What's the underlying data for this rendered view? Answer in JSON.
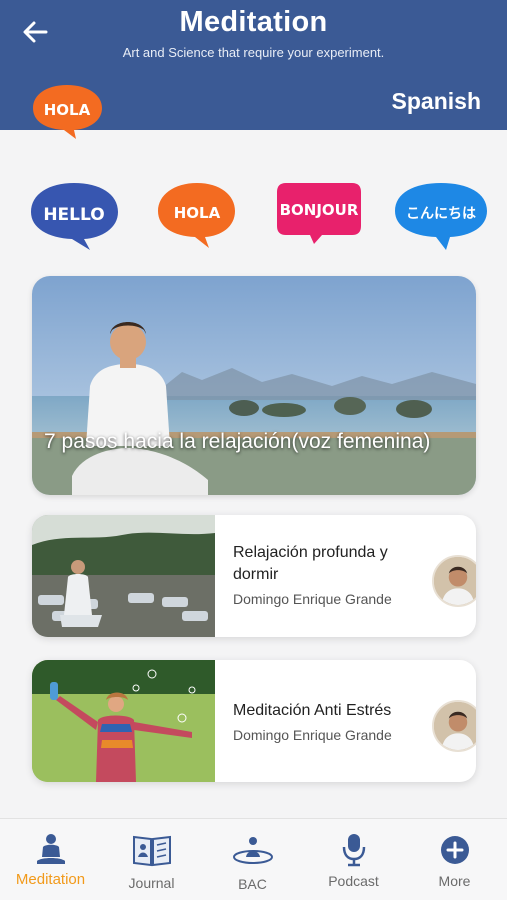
{
  "header": {
    "title": "Meditation",
    "subtitle": "Art and Science that require your experiment.",
    "selected_language": "Spanish",
    "selected_bubble_text": "HOLA",
    "background": "#3b5a95"
  },
  "languages": [
    {
      "text": "HELLO",
      "color": "#3756b0"
    },
    {
      "text": "HOLA",
      "color": "#f36b21"
    },
    {
      "text": "BONJOUR",
      "color": "#e8216c"
    },
    {
      "text": "こんにちは",
      "color": "#1e88e5"
    }
  ],
  "hero": {
    "title": "7 pasos hacia la relajación(voz femenina)"
  },
  "cards": [
    {
      "title": "Relajación profunda y dormir",
      "author": "Domingo Enrique Grande"
    },
    {
      "title": "Meditación Anti Estrés",
      "author": "Domingo Enrique Grande"
    }
  ],
  "nav": [
    {
      "label": "Meditation",
      "icon": "meditation-icon",
      "active": true
    },
    {
      "label": "Journal",
      "icon": "journal-icon",
      "active": false
    },
    {
      "label": "BAC",
      "icon": "bac-icon",
      "active": false
    },
    {
      "label": "Podcast",
      "icon": "podcast-icon",
      "active": false
    },
    {
      "label": "More",
      "icon": "plus-circle-icon",
      "active": false
    }
  ],
  "colors": {
    "active": "#f29a1b",
    "inactive": "#6b6b6b",
    "nav_icon": "#3b5a95"
  }
}
